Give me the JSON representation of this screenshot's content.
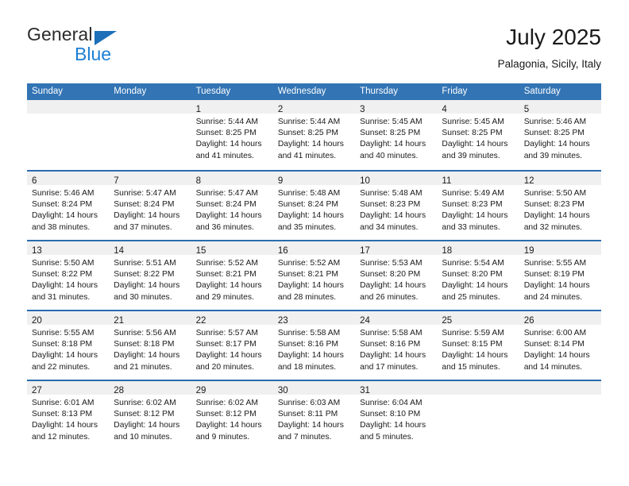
{
  "brand": {
    "name_top": "General",
    "name_bottom": "Blue",
    "accent_color": "#1c7fd4",
    "triangle_color": "#1c6fb8"
  },
  "header": {
    "title": "July 2025",
    "subtitle": "Palagonia, Sicily, Italy"
  },
  "theme": {
    "header_blue": "#3274b4",
    "row_rule_blue": "#2a6cb0",
    "date_strip_gray": "#f0f0f0"
  },
  "weekdays": [
    "Sunday",
    "Monday",
    "Tuesday",
    "Wednesday",
    "Thursday",
    "Friday",
    "Saturday"
  ],
  "weeks": [
    [
      {
        "num": "",
        "lines": []
      },
      {
        "num": "",
        "lines": []
      },
      {
        "num": "1",
        "lines": [
          "Sunrise: 5:44 AM",
          "Sunset: 8:25 PM",
          "Daylight: 14 hours",
          "and 41 minutes."
        ]
      },
      {
        "num": "2",
        "lines": [
          "Sunrise: 5:44 AM",
          "Sunset: 8:25 PM",
          "Daylight: 14 hours",
          "and 41 minutes."
        ]
      },
      {
        "num": "3",
        "lines": [
          "Sunrise: 5:45 AM",
          "Sunset: 8:25 PM",
          "Daylight: 14 hours",
          "and 40 minutes."
        ]
      },
      {
        "num": "4",
        "lines": [
          "Sunrise: 5:45 AM",
          "Sunset: 8:25 PM",
          "Daylight: 14 hours",
          "and 39 minutes."
        ]
      },
      {
        "num": "5",
        "lines": [
          "Sunrise: 5:46 AM",
          "Sunset: 8:25 PM",
          "Daylight: 14 hours",
          "and 39 minutes."
        ]
      }
    ],
    [
      {
        "num": "6",
        "lines": [
          "Sunrise: 5:46 AM",
          "Sunset: 8:24 PM",
          "Daylight: 14 hours",
          "and 38 minutes."
        ]
      },
      {
        "num": "7",
        "lines": [
          "Sunrise: 5:47 AM",
          "Sunset: 8:24 PM",
          "Daylight: 14 hours",
          "and 37 minutes."
        ]
      },
      {
        "num": "8",
        "lines": [
          "Sunrise: 5:47 AM",
          "Sunset: 8:24 PM",
          "Daylight: 14 hours",
          "and 36 minutes."
        ]
      },
      {
        "num": "9",
        "lines": [
          "Sunrise: 5:48 AM",
          "Sunset: 8:24 PM",
          "Daylight: 14 hours",
          "and 35 minutes."
        ]
      },
      {
        "num": "10",
        "lines": [
          "Sunrise: 5:48 AM",
          "Sunset: 8:23 PM",
          "Daylight: 14 hours",
          "and 34 minutes."
        ]
      },
      {
        "num": "11",
        "lines": [
          "Sunrise: 5:49 AM",
          "Sunset: 8:23 PM",
          "Daylight: 14 hours",
          "and 33 minutes."
        ]
      },
      {
        "num": "12",
        "lines": [
          "Sunrise: 5:50 AM",
          "Sunset: 8:23 PM",
          "Daylight: 14 hours",
          "and 32 minutes."
        ]
      }
    ],
    [
      {
        "num": "13",
        "lines": [
          "Sunrise: 5:50 AM",
          "Sunset: 8:22 PM",
          "Daylight: 14 hours",
          "and 31 minutes."
        ]
      },
      {
        "num": "14",
        "lines": [
          "Sunrise: 5:51 AM",
          "Sunset: 8:22 PM",
          "Daylight: 14 hours",
          "and 30 minutes."
        ]
      },
      {
        "num": "15",
        "lines": [
          "Sunrise: 5:52 AM",
          "Sunset: 8:21 PM",
          "Daylight: 14 hours",
          "and 29 minutes."
        ]
      },
      {
        "num": "16",
        "lines": [
          "Sunrise: 5:52 AM",
          "Sunset: 8:21 PM",
          "Daylight: 14 hours",
          "and 28 minutes."
        ]
      },
      {
        "num": "17",
        "lines": [
          "Sunrise: 5:53 AM",
          "Sunset: 8:20 PM",
          "Daylight: 14 hours",
          "and 26 minutes."
        ]
      },
      {
        "num": "18",
        "lines": [
          "Sunrise: 5:54 AM",
          "Sunset: 8:20 PM",
          "Daylight: 14 hours",
          "and 25 minutes."
        ]
      },
      {
        "num": "19",
        "lines": [
          "Sunrise: 5:55 AM",
          "Sunset: 8:19 PM",
          "Daylight: 14 hours",
          "and 24 minutes."
        ]
      }
    ],
    [
      {
        "num": "20",
        "lines": [
          "Sunrise: 5:55 AM",
          "Sunset: 8:18 PM",
          "Daylight: 14 hours",
          "and 22 minutes."
        ]
      },
      {
        "num": "21",
        "lines": [
          "Sunrise: 5:56 AM",
          "Sunset: 8:18 PM",
          "Daylight: 14 hours",
          "and 21 minutes."
        ]
      },
      {
        "num": "22",
        "lines": [
          "Sunrise: 5:57 AM",
          "Sunset: 8:17 PM",
          "Daylight: 14 hours",
          "and 20 minutes."
        ]
      },
      {
        "num": "23",
        "lines": [
          "Sunrise: 5:58 AM",
          "Sunset: 8:16 PM",
          "Daylight: 14 hours",
          "and 18 minutes."
        ]
      },
      {
        "num": "24",
        "lines": [
          "Sunrise: 5:58 AM",
          "Sunset: 8:16 PM",
          "Daylight: 14 hours",
          "and 17 minutes."
        ]
      },
      {
        "num": "25",
        "lines": [
          "Sunrise: 5:59 AM",
          "Sunset: 8:15 PM",
          "Daylight: 14 hours",
          "and 15 minutes."
        ]
      },
      {
        "num": "26",
        "lines": [
          "Sunrise: 6:00 AM",
          "Sunset: 8:14 PM",
          "Daylight: 14 hours",
          "and 14 minutes."
        ]
      }
    ],
    [
      {
        "num": "27",
        "lines": [
          "Sunrise: 6:01 AM",
          "Sunset: 8:13 PM",
          "Daylight: 14 hours",
          "and 12 minutes."
        ]
      },
      {
        "num": "28",
        "lines": [
          "Sunrise: 6:02 AM",
          "Sunset: 8:12 PM",
          "Daylight: 14 hours",
          "and 10 minutes."
        ]
      },
      {
        "num": "29",
        "lines": [
          "Sunrise: 6:02 AM",
          "Sunset: 8:12 PM",
          "Daylight: 14 hours",
          "and 9 minutes."
        ]
      },
      {
        "num": "30",
        "lines": [
          "Sunrise: 6:03 AM",
          "Sunset: 8:11 PM",
          "Daylight: 14 hours",
          "and 7 minutes."
        ]
      },
      {
        "num": "31",
        "lines": [
          "Sunrise: 6:04 AM",
          "Sunset: 8:10 PM",
          "Daylight: 14 hours",
          "and 5 minutes."
        ]
      },
      {
        "num": "",
        "lines": []
      },
      {
        "num": "",
        "lines": []
      }
    ]
  ]
}
